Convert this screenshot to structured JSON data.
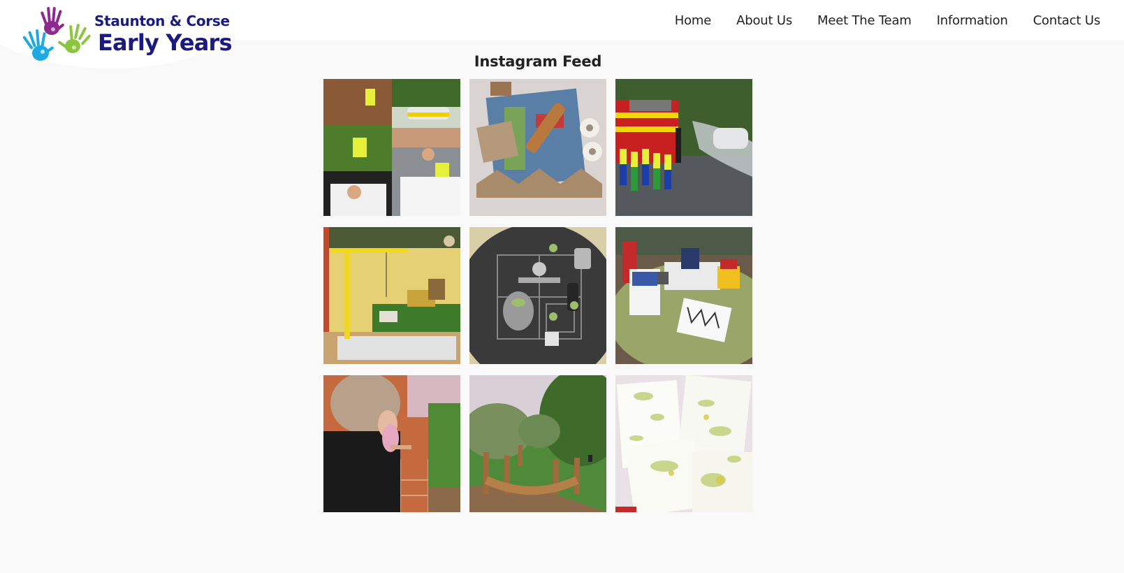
{
  "brand": {
    "line1": "Staunton & Corse",
    "line2": "Early Years",
    "color": "#1a1a80",
    "hand_colors": [
      "#8e2a8e",
      "#1ea9e1",
      "#8cc63f"
    ]
  },
  "nav": {
    "items": [
      {
        "label": "Home"
      },
      {
        "label": "About Us"
      },
      {
        "label": "Meet The Team"
      },
      {
        "label": "Information"
      },
      {
        "label": "Contact Us"
      }
    ]
  },
  "feed": {
    "title": "Instagram Feed",
    "photos": [
      {
        "subject": "children in hi-vis vests with police car collage"
      },
      {
        "subject": "cardboard tubes, bark and cotton reels on play mat"
      },
      {
        "subject": "children in hi-vis vests beside fire engine spraying water"
      },
      {
        "subject": "toy crane and diggers on grass tray"
      },
      {
        "subject": "scales and dough balls on chalk road tray"
      },
      {
        "subject": "toy post office table with letters"
      },
      {
        "subject": "child looking at plants in garden planter"
      },
      {
        "subject": "wooden balance bridge in playground park"
      },
      {
        "subject": "leaf and flower prints on white paper"
      }
    ]
  }
}
